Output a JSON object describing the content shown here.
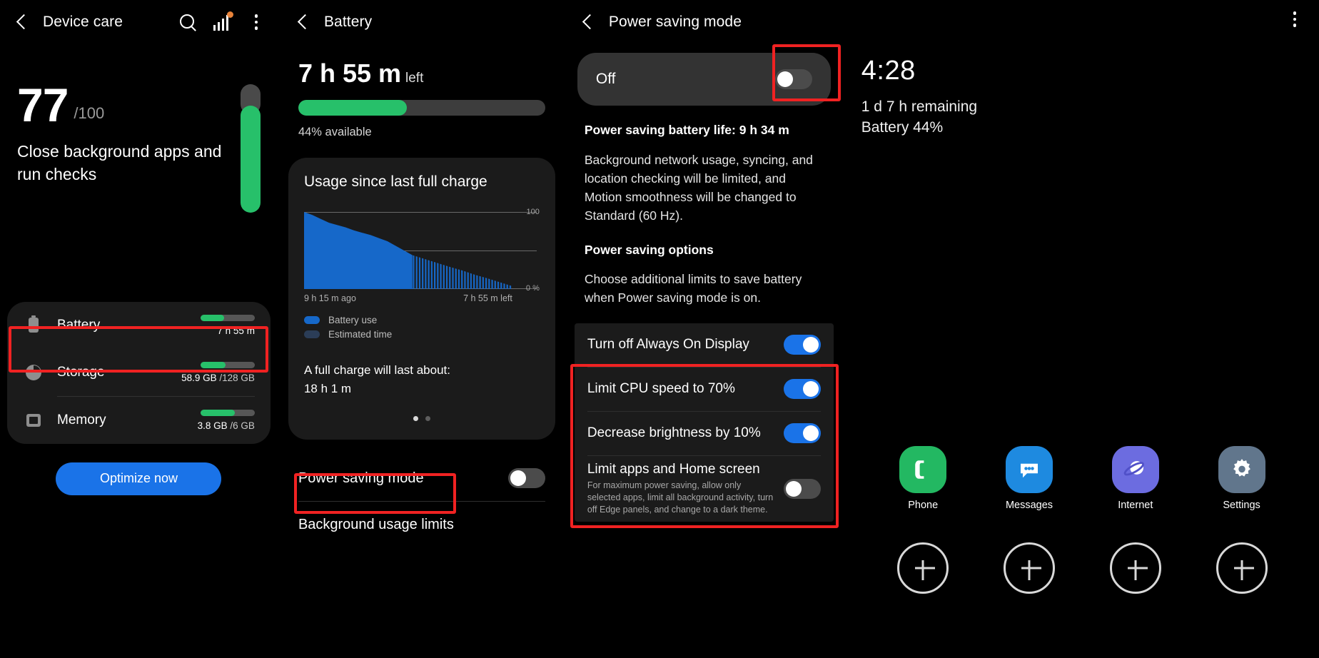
{
  "panel1": {
    "appbar": {
      "title": "Device care",
      "search_icon": "search-icon",
      "signal_icon": "signal-bars-icon",
      "menu_icon": "kebab-menu-icon"
    },
    "score": {
      "value": "77",
      "denominator": "/100",
      "message": "Close background apps and run checks"
    },
    "rows": [
      {
        "label": "Battery",
        "value_main": "7 h 55 m",
        "value_sub": "",
        "bar_pct": 44,
        "icon": "battery-icon"
      },
      {
        "label": "Storage",
        "value_main": "58.9 GB",
        "value_sub": " /128 GB",
        "bar_pct": 46,
        "icon": "storage-pie-icon"
      },
      {
        "label": "Memory",
        "value_main": "3.8 GB",
        "value_sub": " /6 GB",
        "bar_pct": 63,
        "icon": "memory-chip-icon"
      }
    ],
    "optimize_button": "Optimize now"
  },
  "panel2": {
    "appbar": {
      "title": "Battery"
    },
    "time_left": "7 h 55 m",
    "time_left_suffix": "left",
    "battery_pct": 44,
    "available_label": "44% available",
    "chart_card": {
      "title": "Usage since last full charge",
      "axis_top": "100",
      "axis_bottom": "0 %",
      "foot_left": "9 h 15 m ago",
      "foot_right": "7 h 55 m left",
      "legend": [
        {
          "label": "Battery use",
          "color": "#1668c9"
        },
        {
          "label": "Estimated time",
          "color": "#2b3d57"
        }
      ],
      "full_charge_label": "A full charge will last about:",
      "full_charge_value": "18 h 1 m",
      "page_dots": 2,
      "active_dot": 0
    },
    "rows": [
      {
        "label": "Power saving mode",
        "toggle": "off"
      },
      {
        "label": "Background usage limits",
        "toggle": null
      }
    ]
  },
  "panel3": {
    "appbar": {
      "title": "Power saving mode"
    },
    "master": {
      "label": "Off",
      "toggle": "off"
    },
    "battery_life_heading": "Power saving battery life: 9 h 34 m",
    "description": "Background network usage, syncing, and location checking will be limited, and Motion smoothness will be changed to Standard (60 Hz).",
    "options_heading": "Power saving options",
    "options_desc": "Choose additional limits to save battery when Power saving mode is on.",
    "options": [
      {
        "title": "Turn off Always On Display",
        "desc": "",
        "toggle": "on"
      },
      {
        "title": "Limit CPU speed to 70%",
        "desc": "",
        "toggle": "on"
      },
      {
        "title": "Decrease brightness by 10%",
        "desc": "",
        "toggle": "on"
      },
      {
        "title": "Limit apps and Home screen",
        "desc": "For maximum power saving, allow only selected apps, limit all background activity, turn off Edge panels, and change to a dark theme.",
        "toggle": "off"
      }
    ]
  },
  "panel4": {
    "menu_icon": "kebab-menu-icon",
    "clock": "4:28",
    "remaining": "1 d 7 h remaining",
    "battery_line": "Battery 44%",
    "apps": [
      {
        "label": "Phone",
        "icon": "phone-icon",
        "bg": "#23b862"
      },
      {
        "label": "Messages",
        "icon": "messages-icon",
        "bg": "#1e8ae0"
      },
      {
        "label": "Internet",
        "icon": "internet-icon",
        "bg": "#6c6ce0"
      },
      {
        "label": "Settings",
        "icon": "gear-icon",
        "bg": "#61768c"
      }
    ],
    "placeholders": 4
  },
  "chart_data": {
    "type": "area",
    "title": "Usage since last full charge",
    "xlabel": "",
    "ylabel": "%",
    "ylim": [
      0,
      100
    ],
    "axis_tick_labels": [
      "100",
      "0 %"
    ],
    "x_tick_labels": [
      "9 h 15 m ago",
      "7 h 55 m left"
    ],
    "legend": [
      "Battery use",
      "Estimated time"
    ],
    "legend_position": "bottom-left",
    "grid": true,
    "series": [
      {
        "name": "Battery use",
        "x": [
          0,
          4,
          8,
          12,
          16,
          20,
          24,
          28,
          32,
          36,
          40,
          44,
          48,
          52
        ],
        "values": [
          100,
          96,
          91,
          86,
          83,
          80,
          76,
          73,
          70,
          66,
          62,
          56,
          50,
          44
        ]
      },
      {
        "name": "Estimated time",
        "x": [
          52,
          58,
          64,
          70,
          76,
          82,
          88,
          94,
          100
        ],
        "values": [
          44,
          39,
          34,
          29,
          24,
          18,
          13,
          7,
          0
        ]
      }
    ]
  },
  "highlight_color": "#f02222"
}
